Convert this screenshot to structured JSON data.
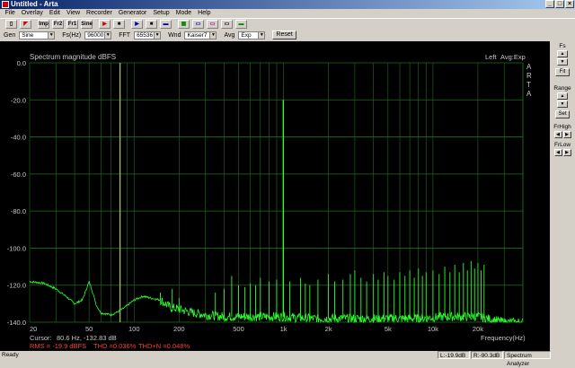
{
  "window": {
    "title": "Untitled - Arta"
  },
  "menu": [
    "File",
    "Overlay",
    "Edit",
    "View",
    "Recorder",
    "Generator",
    "Setup",
    "Mode",
    "Help"
  ],
  "toolbar": {
    "buttons": [
      "new-file",
      "open-file",
      "Imp",
      "Fr2",
      "Fr1",
      "Sine",
      "record",
      "stop",
      "play",
      "stop-play",
      "avg",
      "zoom",
      "peak",
      "scope",
      "fft",
      "color"
    ]
  },
  "genbar": {
    "gen_label": "Gen",
    "gen_value": "Sine",
    "fs_label": "Fs(Hz)",
    "fs_value": "96000",
    "fft_label": "FFT",
    "fft_value": "65536",
    "wnd_label": "Wnd",
    "wnd_value": "Kaiser7",
    "avg_label": "Avg",
    "avg_value": "Exp",
    "reset_label": "Reset"
  },
  "plot": {
    "title": "Spectrum magnitude dBFS",
    "mode_left": "Left",
    "mode_avg": "Avg:Exp",
    "arta_letters": [
      "A",
      "R",
      "T",
      "A"
    ],
    "cursor_label": "Cursor:",
    "cursor_value": "80.6 Hz, -132.83 dB",
    "rms_text": "RMS = -19.9 dBFS",
    "thd_text": "THD =0.036%",
    "thdn_text": "THD+N =0.048%",
    "xlabel": "Frequency(Hz)"
  },
  "right_panel": {
    "fs_label": "Fs",
    "fit_label": "Fit",
    "range_label": "Range",
    "set_label": "Set",
    "frhigh_label": "FrHigh",
    "frlow_label": "FrLow"
  },
  "status": {
    "left": "Ready",
    "l_level": "L:-19.9dB",
    "r_level": "R:-90.3dB",
    "mode": "Spectrum Analyzer"
  },
  "colors": {
    "trace": "#2bff2b",
    "grid": "#1e6e1e",
    "cursor_line": "#b9b96c",
    "axis_text": "#c8c8c8",
    "red_text": "#ff3c3c"
  },
  "chart_data": {
    "type": "line",
    "title": "Spectrum magnitude dBFS",
    "xlabel": "Frequency(Hz)",
    "ylabel": "",
    "x_scale": "log",
    "xlim": [
      20,
      40000
    ],
    "ylim": [
      -140,
      0
    ],
    "x_ticks": [
      20,
      50,
      100,
      200,
      500,
      1000,
      2000,
      5000,
      10000,
      20000
    ],
    "x_tick_labels": [
      "20",
      "50",
      "100",
      "200",
      "500",
      "1k",
      "2k",
      "5k",
      "10k",
      "20k"
    ],
    "y_ticks": [
      0,
      -20,
      -40,
      -60,
      -80,
      -100,
      -120,
      -140
    ],
    "y_tick_labels": [
      "0.0",
      "-20.0",
      "-40.0",
      "-60.0",
      "-80.0",
      "-100.0",
      "-120.0",
      "-140.0"
    ],
    "grid": true,
    "cursor_x": 80.6,
    "noise_floor": [
      [
        20,
        -118
      ],
      [
        25,
        -119
      ],
      [
        30,
        -122
      ],
      [
        35,
        -126
      ],
      [
        40,
        -130
      ],
      [
        45,
        -128
      ],
      [
        48,
        -122
      ],
      [
        50,
        -118
      ],
      [
        52,
        -122
      ],
      [
        56,
        -131
      ],
      [
        60,
        -135
      ],
      [
        70,
        -136
      ],
      [
        80,
        -134
      ],
      [
        90,
        -131
      ],
      [
        100,
        -128
      ],
      [
        115,
        -126
      ],
      [
        130,
        -127
      ],
      [
        150,
        -128
      ],
      [
        175,
        -132
      ],
      [
        200,
        -133
      ],
      [
        250,
        -135
      ],
      [
        300,
        -136
      ],
      [
        400,
        -137
      ],
      [
        500,
        -137
      ],
      [
        700,
        -137
      ],
      [
        1000,
        -137
      ],
      [
        1500,
        -138
      ],
      [
        2000,
        -138
      ],
      [
        3000,
        -138
      ],
      [
        5000,
        -138
      ],
      [
        8000,
        -138
      ],
      [
        12000,
        -137
      ],
      [
        16000,
        -137
      ],
      [
        20000,
        -137
      ],
      [
        23000,
        -138
      ],
      [
        26000,
        -139
      ],
      [
        30000,
        -140
      ],
      [
        40000,
        -140
      ]
    ],
    "peaks": [
      [
        100,
        -128
      ],
      [
        150,
        -124
      ],
      [
        180,
        -122
      ],
      [
        200,
        -127
      ],
      [
        350,
        -124
      ],
      [
        400,
        -122
      ],
      [
        450,
        -115
      ],
      [
        500,
        -120
      ],
      [
        550,
        -121
      ],
      [
        600,
        -119
      ],
      [
        650,
        -120
      ],
      [
        700,
        -116
      ],
      [
        800,
        -118
      ],
      [
        900,
        -117
      ],
      [
        997,
        -20
      ],
      [
        1100,
        -118
      ],
      [
        1300,
        -116
      ],
      [
        1400,
        -119
      ],
      [
        1500,
        -120
      ],
      [
        1700,
        -117
      ],
      [
        2000,
        -114
      ],
      [
        2200,
        -118
      ],
      [
        2500,
        -117
      ],
      [
        2800,
        -114
      ],
      [
        3000,
        -112
      ],
      [
        3300,
        -116
      ],
      [
        3600,
        -118
      ],
      [
        4000,
        -114
      ],
      [
        4300,
        -117
      ],
      [
        4700,
        -113
      ],
      [
        5000,
        -115
      ],
      [
        5500,
        -117
      ],
      [
        6000,
        -113
      ],
      [
        6500,
        -115
      ],
      [
        7000,
        -112
      ],
      [
        7500,
        -116
      ],
      [
        8000,
        -111
      ],
      [
        8500,
        -115
      ],
      [
        9000,
        -113
      ],
      [
        10000,
        -112
      ],
      [
        11000,
        -114
      ],
      [
        12000,
        -110
      ],
      [
        13000,
        -113
      ],
      [
        14000,
        -109
      ],
      [
        15000,
        -113
      ],
      [
        16000,
        -108
      ],
      [
        17000,
        -112
      ],
      [
        18000,
        -107
      ],
      [
        19000,
        -111
      ],
      [
        20000,
        -108
      ],
      [
        21000,
        -112
      ],
      [
        22000,
        -109
      ]
    ]
  }
}
